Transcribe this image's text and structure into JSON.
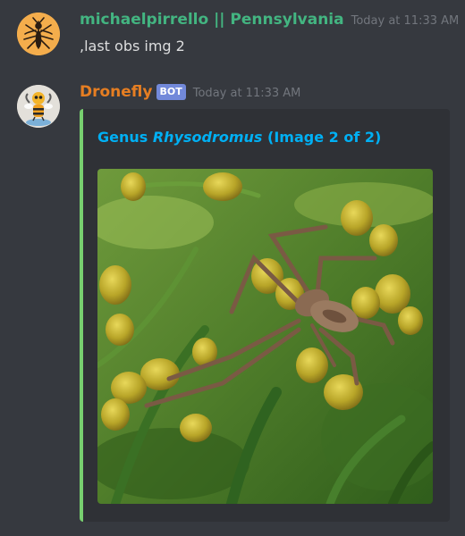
{
  "messages": [
    {
      "username": "michaelpirrello || Pennsylvania",
      "username_color": "#43b581",
      "timestamp": "Today at 11:33 AM",
      "content": ",last obs img 2",
      "avatar_icon": "mosquito-icon"
    },
    {
      "username": "Dronefly",
      "username_color": "#e67e22",
      "bot_tag": "BOT",
      "timestamp": "Today at 11:33 AM",
      "avatar_icon": "bee-robot-icon",
      "embed": {
        "accent_color": "#77cf6f",
        "title_prefix": "Genus ",
        "title_taxon": "Rhysodromus",
        "title_suffix": " (Image 2 of 2)",
        "title_color": "#00b0f4",
        "image_subject": "spider-on-yellow-flowers"
      }
    }
  ]
}
